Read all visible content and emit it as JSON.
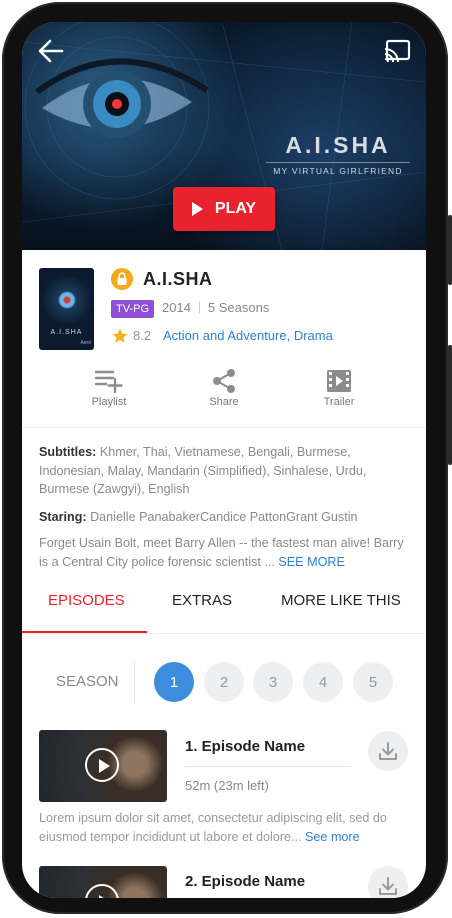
{
  "hero": {
    "title": "A.I.SHA",
    "subtitle": "MY VIRTUAL GIRLFRIEND",
    "play_label": "PLAY"
  },
  "show": {
    "poster_title": "A.I.SHA",
    "poster_brand": "Aero",
    "title": "A.I.SHA",
    "rating": "TV-PG",
    "year": "2014",
    "seasons": "5 Seasons",
    "score": "8.2",
    "genres": "Action and Adventure, Drama"
  },
  "actions": [
    {
      "label": "Playlist",
      "icon": "playlist-add-icon"
    },
    {
      "label": "Share",
      "icon": "share-icon"
    },
    {
      "label": "Trailer",
      "icon": "film-icon"
    }
  ],
  "details": {
    "subtitles_label": "Subtitles:",
    "subtitles": "Khmer,  Thai, Vietnamese, Bengali, Burmese, Indonesian, Malay, Mandarin (Simplified), Sinhalese, Urdu, Burmese (Zawgyi), English",
    "staring_label": "Staring:",
    "staring": "Danielle PanabakerCandice PattonGrant Gustin",
    "synopsis": "Forget Usain Bolt, meet Barry Allen -- the fastest man alive! Barry is a Central City police forensic scientist ...",
    "see_more": "SEE MORE"
  },
  "tabs": [
    "EPISODES",
    "EXTRAS",
    "MORE LIKE THIS"
  ],
  "active_tab": "EPISODES",
  "season": {
    "label": "SEASON",
    "options": [
      "1",
      "2",
      "3",
      "4",
      "5"
    ],
    "selected": "1"
  },
  "episodes": [
    {
      "name": "1. Episode Name",
      "duration": "52m (23m left)",
      "description": "Lorem ipsum dolor sit amet, consectetur adipiscing elit, sed do eiusmod tempor incididunt ut labore et dolore...",
      "more": "See more"
    },
    {
      "name": "2. Episode Name"
    }
  ],
  "colors": {
    "accent_red": "#e8232f",
    "link_blue": "#2e7fd4",
    "season_active": "#3e8ddd",
    "rating_purple": "#8f4fd9",
    "lock_orange": "#f6a821"
  }
}
